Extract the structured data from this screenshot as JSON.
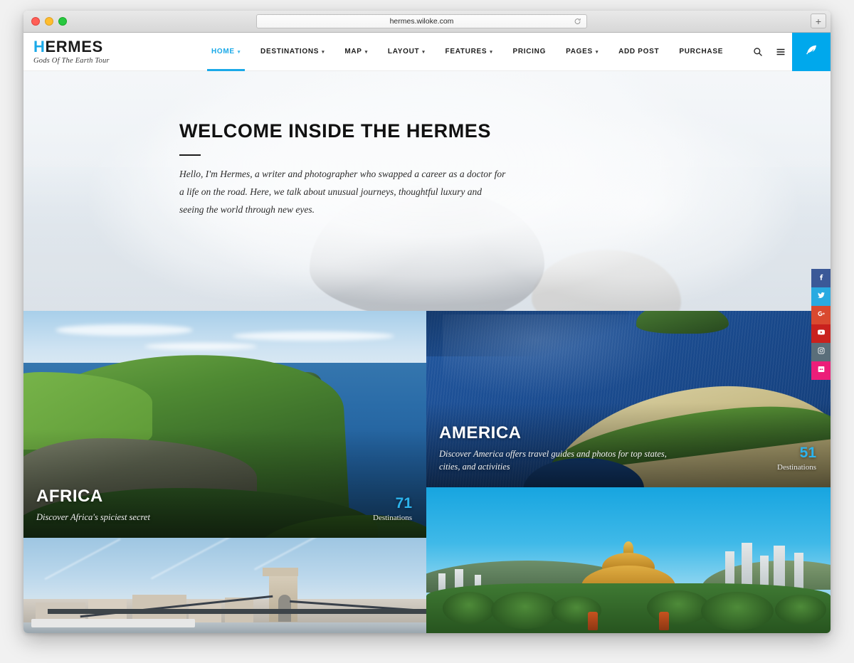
{
  "browser": {
    "url": "hermes.wiloke.com",
    "reload_icon": "reload-icon",
    "newtab_label": "+",
    "traffic_lights": [
      "close",
      "minimize",
      "zoom"
    ]
  },
  "header": {
    "logo_first": "H",
    "logo_rest": "ERMES",
    "tagline": "Gods Of The Earth Tour",
    "accent_color": "#00a8ec",
    "nav": [
      {
        "label": "HOME",
        "has_caret": true,
        "active": true
      },
      {
        "label": "DESTINATIONS",
        "has_caret": true,
        "active": false
      },
      {
        "label": "MAP",
        "has_caret": true,
        "active": false
      },
      {
        "label": "LAYOUT",
        "has_caret": true,
        "active": false
      },
      {
        "label": "FEATURES",
        "has_caret": true,
        "active": false
      },
      {
        "label": "PRICING",
        "has_caret": false,
        "active": false
      },
      {
        "label": "PAGES",
        "has_caret": true,
        "active": false
      },
      {
        "label": "ADD POST",
        "has_caret": false,
        "active": false
      },
      {
        "label": "PURCHASE",
        "has_caret": false,
        "active": false
      }
    ],
    "tools": {
      "search": "search-icon",
      "menu": "hamburger-menu-icon",
      "write": "feather-pen-icon"
    }
  },
  "hero": {
    "title": "WELCOME INSIDE THE HERMES",
    "paragraph": "Hello, I'm Hermes, a writer and photographer who swapped a career as a doctor for a life on the road. Here, we talk about unusual journeys, thoughtful luxury and seeing the world through new eyes."
  },
  "destinations": {
    "count_label": "Destinations",
    "cards": [
      {
        "id": "africa",
        "title": "AFRICA",
        "subtitle": "Discover Africa's spiciest secret",
        "count": "71",
        "count_label": "Destinations",
        "image_alt": "green coastal cliff over blue sea with small island"
      },
      {
        "id": "america",
        "title": "AMERICA",
        "subtitle": "Discover America offers travel guides and photos for top states, cities, and activities",
        "count": "51",
        "count_label": "Destinations",
        "image_alt": "aerial view of deep blue lake with tan sandbar"
      },
      {
        "id": "bridge",
        "title": "",
        "subtitle": "",
        "count": "",
        "count_label": "",
        "image_alt": "Chain Bridge over the Danube in Budapest"
      },
      {
        "id": "pagoda",
        "title": "",
        "subtitle": "",
        "count": "",
        "count_label": "",
        "image_alt": "golden pagoda in Nan Lian Garden Hong Kong"
      }
    ]
  },
  "social": [
    {
      "name": "facebook",
      "icon": "facebook-icon",
      "color": "#3b5998"
    },
    {
      "name": "twitter",
      "icon": "twitter-icon",
      "color": "#29aae1"
    },
    {
      "name": "googleplus",
      "icon": "google-plus-icon",
      "color": "#d9492f"
    },
    {
      "name": "youtube",
      "icon": "youtube-icon",
      "color": "#c9211e"
    },
    {
      "name": "instagram",
      "icon": "instagram-icon",
      "color": "#5a6e7a"
    },
    {
      "name": "dribbble",
      "icon": "dribbble-icon",
      "color": "#ec1e79"
    }
  ]
}
